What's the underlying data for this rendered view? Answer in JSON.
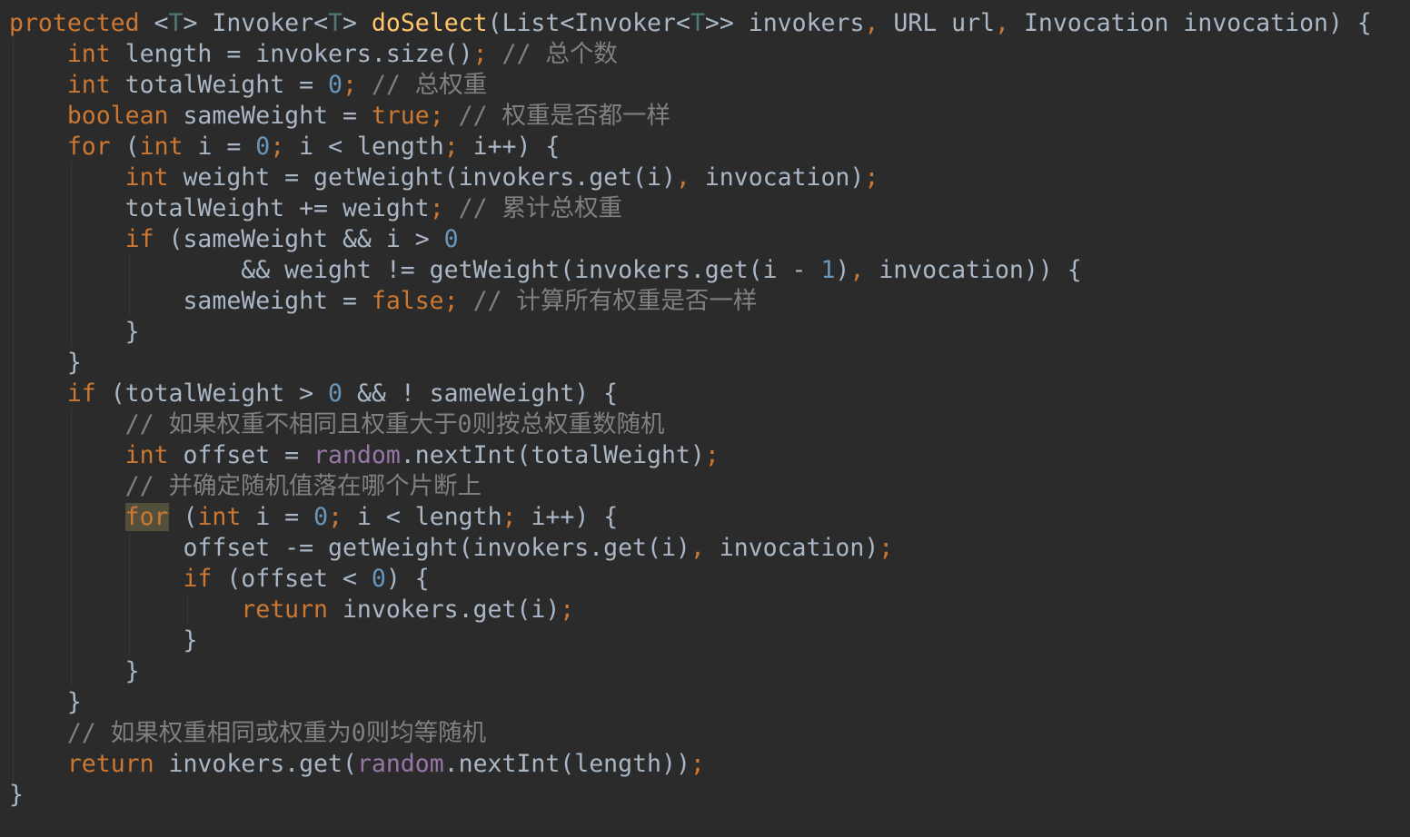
{
  "editor": {
    "theme": "darcula",
    "colors": {
      "background": "#2b2b2b",
      "text": "#a9b7c6",
      "keyword": "#cc7832",
      "method": "#ffc66d",
      "number": "#6897bb",
      "comment": "#808080",
      "field": "#9876aa",
      "type_param": "#507874",
      "highlight": "#52503a"
    },
    "lines": [
      [
        [
          "kw",
          "protected"
        ],
        [
          "txt",
          " <"
        ],
        [
          "tp",
          "T"
        ],
        [
          "txt",
          "> Invoker<"
        ],
        [
          "tp",
          "T"
        ],
        [
          "txt",
          "> "
        ],
        [
          "fn",
          "doSelect"
        ],
        [
          "txt",
          "(List<Invoker<"
        ],
        [
          "tp",
          "T"
        ],
        [
          "txt",
          ">> invokers"
        ],
        [
          "kw",
          ","
        ],
        [
          "txt",
          " URL url"
        ],
        [
          "kw",
          ","
        ],
        [
          "txt",
          " Invocation invocation) {"
        ]
      ],
      [
        [
          "txt",
          "    "
        ],
        [
          "kw",
          "int"
        ],
        [
          "txt",
          " length = invokers.size()"
        ],
        [
          "kw",
          ";"
        ],
        [
          "txt",
          " "
        ],
        [
          "cm",
          "// 总个数"
        ]
      ],
      [
        [
          "txt",
          "    "
        ],
        [
          "kw",
          "int"
        ],
        [
          "txt",
          " totalWeight = "
        ],
        [
          "num",
          "0"
        ],
        [
          "kw",
          ";"
        ],
        [
          "txt",
          " "
        ],
        [
          "cm",
          "// 总权重"
        ]
      ],
      [
        [
          "txt",
          "    "
        ],
        [
          "kw",
          "boolean"
        ],
        [
          "txt",
          " sameWeight = "
        ],
        [
          "kw",
          "true;"
        ],
        [
          "txt",
          " "
        ],
        [
          "cm",
          "// 权重是否都一样"
        ]
      ],
      [
        [
          "txt",
          "    "
        ],
        [
          "kw",
          "for"
        ],
        [
          "txt",
          " ("
        ],
        [
          "kw",
          "int"
        ],
        [
          "txt",
          " i = "
        ],
        [
          "num",
          "0"
        ],
        [
          "kw",
          ";"
        ],
        [
          "txt",
          " i < length"
        ],
        [
          "kw",
          ";"
        ],
        [
          "txt",
          " i++) {"
        ]
      ],
      [
        [
          "txt",
          "        "
        ],
        [
          "kw",
          "int"
        ],
        [
          "txt",
          " weight = getWeight(invokers.get(i)"
        ],
        [
          "kw",
          ","
        ],
        [
          "txt",
          " invocation)"
        ],
        [
          "kw",
          ";"
        ]
      ],
      [
        [
          "txt",
          "        totalWeight += weight"
        ],
        [
          "kw",
          ";"
        ],
        [
          "txt",
          " "
        ],
        [
          "cm",
          "// 累计总权重"
        ]
      ],
      [
        [
          "txt",
          "        "
        ],
        [
          "kw",
          "if"
        ],
        [
          "txt",
          " (sameWeight && i > "
        ],
        [
          "num",
          "0"
        ]
      ],
      [
        [
          "txt",
          "                && weight != getWeight(invokers.get(i - "
        ],
        [
          "num",
          "1"
        ],
        [
          "txt",
          ")"
        ],
        [
          "kw",
          ","
        ],
        [
          "txt",
          " invocation)) {"
        ]
      ],
      [
        [
          "txt",
          "            sameWeight = "
        ],
        [
          "kw",
          "false;"
        ],
        [
          "txt",
          " "
        ],
        [
          "cm",
          "// 计算所有权重是否一样"
        ]
      ],
      [
        [
          "txt",
          "        }"
        ]
      ],
      [
        [
          "txt",
          "    }"
        ]
      ],
      [
        [
          "txt",
          "    "
        ],
        [
          "kw",
          "if"
        ],
        [
          "txt",
          " (totalWeight > "
        ],
        [
          "num",
          "0"
        ],
        [
          "txt",
          " && ! sameWeight) {"
        ]
      ],
      [
        [
          "txt",
          "        "
        ],
        [
          "cm",
          "// 如果权重不相同且权重大于0则按总权重数随机"
        ]
      ],
      [
        [
          "txt",
          "        "
        ],
        [
          "kw",
          "int"
        ],
        [
          "txt",
          " offset = "
        ],
        [
          "fld",
          "random"
        ],
        [
          "txt",
          ".nextInt(totalWeight)"
        ],
        [
          "kw",
          ";"
        ]
      ],
      [
        [
          "txt",
          "        "
        ],
        [
          "cm",
          "// 并确定随机值落在哪个片断上"
        ]
      ],
      [
        [
          "txt",
          "        "
        ],
        [
          "kw hl",
          "for"
        ],
        [
          "txt",
          " ("
        ],
        [
          "kw",
          "int"
        ],
        [
          "txt",
          " i = "
        ],
        [
          "num",
          "0"
        ],
        [
          "kw",
          ";"
        ],
        [
          "txt",
          " i < length"
        ],
        [
          "kw",
          ";"
        ],
        [
          "txt",
          " i++) {"
        ]
      ],
      [
        [
          "txt",
          "            offset -= getWeight(invokers.get(i)"
        ],
        [
          "kw",
          ","
        ],
        [
          "txt",
          " invocation)"
        ],
        [
          "kw",
          ";"
        ]
      ],
      [
        [
          "txt",
          "            "
        ],
        [
          "kw",
          "if"
        ],
        [
          "txt",
          " (offset < "
        ],
        [
          "num",
          "0"
        ],
        [
          "txt",
          ") {"
        ]
      ],
      [
        [
          "txt",
          "                "
        ],
        [
          "kw",
          "return"
        ],
        [
          "txt",
          " invokers.get(i)"
        ],
        [
          "kw",
          ";"
        ]
      ],
      [
        [
          "txt",
          "            }"
        ]
      ],
      [
        [
          "txt",
          "        }"
        ]
      ],
      [
        [
          "txt",
          "    }"
        ]
      ],
      [
        [
          "txt",
          "    "
        ],
        [
          "cm",
          "// 如果权重相同或权重为0则均等随机"
        ]
      ],
      [
        [
          "txt",
          "    "
        ],
        [
          "kw",
          "return"
        ],
        [
          "txt",
          " invokers.get("
        ],
        [
          "fld",
          "random"
        ],
        [
          "txt",
          ".nextInt(length))"
        ],
        [
          "kw",
          ";"
        ]
      ],
      [
        [
          "txt",
          "}"
        ]
      ]
    ]
  }
}
